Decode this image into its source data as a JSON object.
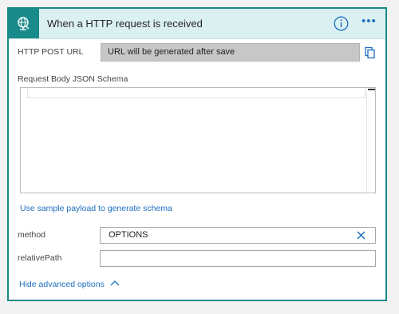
{
  "header": {
    "title": "When a HTTP request is received",
    "trigger_icon": "globe-request-icon",
    "info_icon": "info-icon",
    "more_icon": "more-options-icon",
    "more_glyph": "•••",
    "accent": "#1a8b8b",
    "header_bg": "#dbf0f3"
  },
  "http_post_url": {
    "label": "HTTP POST URL",
    "value": "URL will be generated after save",
    "copy_icon": "copy-icon"
  },
  "schema": {
    "label": "Request Body JSON Schema",
    "value": ""
  },
  "sample_payload_link": "Use sample payload to generate schema",
  "method": {
    "label": "method",
    "value": "OPTIONS",
    "clear_icon": "clear-icon"
  },
  "relative_path": {
    "label": "relativePath",
    "value": ""
  },
  "advanced": {
    "label": "Hide advanced options",
    "chevron_icon": "chevron-up-icon"
  },
  "link_color": "#1e6fbf"
}
